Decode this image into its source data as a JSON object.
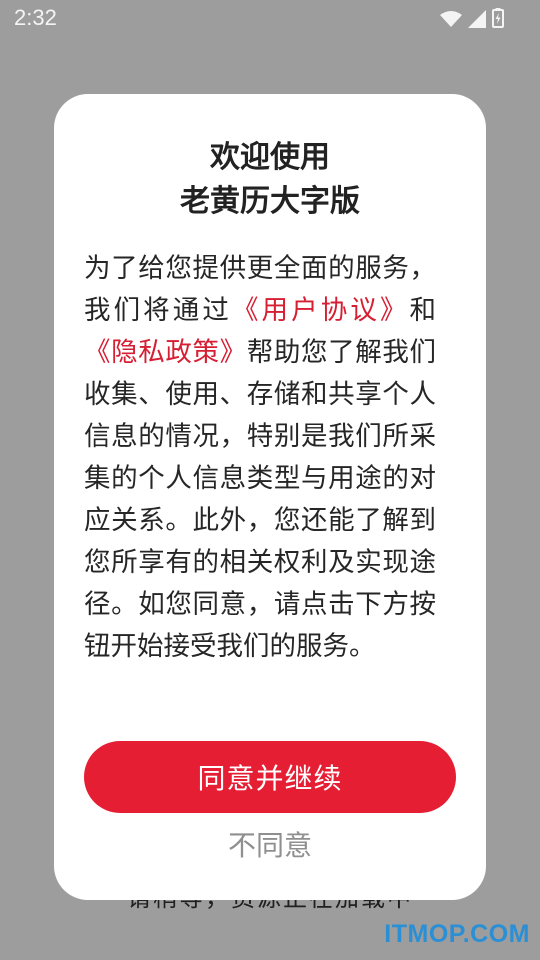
{
  "status_bar": {
    "time": "2:32",
    "icons": [
      "wifi-icon",
      "cellular-signal-icon",
      "battery-icon"
    ]
  },
  "background": {
    "partial_text": "请稍等，资源正在加载中"
  },
  "dialog": {
    "title_line1": "欢迎使用",
    "title_line2": "老黄历大字版",
    "body": {
      "part1": "为了给您提供更全面的服务，我们将通过",
      "user_agreement": "《用户协议》",
      "and": "和",
      "privacy_policy": "《隐私政策》",
      "part2": "帮助您了解我们收集、使用、存储和共享个人信息的情况，特别是我们所采集的个人信息类型与用途的对应关系。此外，您还能了解到您所享有的相关权利及实现途径。如您同意，请点击下方按钮开始接受我们的服务。"
    },
    "agree_label": "同意并继续",
    "disagree_label": "不同意"
  },
  "watermark": "ITMOP.COM",
  "colors": {
    "accent_red": "#e61e34",
    "link_red": "#d61f33",
    "overlay_gray": "#9d9d9d",
    "watermark_blue": "#2b8fd6"
  }
}
